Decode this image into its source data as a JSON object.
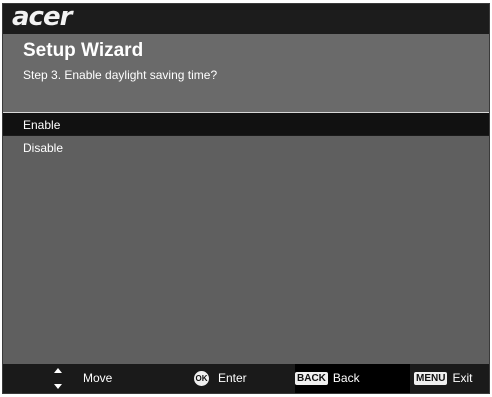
{
  "brand": {
    "logo_text": "acer"
  },
  "wizard": {
    "title": "Setup Wizard",
    "step": "Step 3. Enable daylight saving time?"
  },
  "options": [
    {
      "label": "Enable",
      "selected": true
    },
    {
      "label": "Disable",
      "selected": false
    }
  ],
  "footer": {
    "move_label": "Move",
    "ok_key": "OK",
    "enter_label": "Enter",
    "back_key": "BACK",
    "back_label": "Back",
    "menu_key": "MENU",
    "exit_label": "Exit",
    "move_icon": "up-down-arrows-icon"
  },
  "colors": {
    "background": "#5f5f5f",
    "header": "#1c1c1c",
    "selected_row": "#111111",
    "text": "#ffffff"
  }
}
